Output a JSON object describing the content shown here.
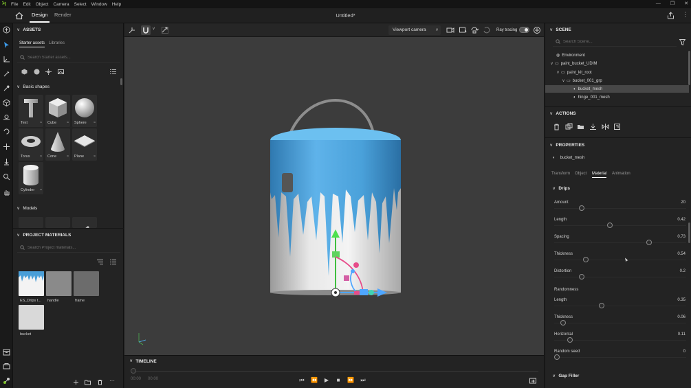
{
  "menu": [
    "File",
    "Edit",
    "Object",
    "Camera",
    "Select",
    "Window",
    "Help"
  ],
  "header": {
    "tabs": [
      "Design",
      "Render"
    ],
    "doc_title": "Untitled*"
  },
  "assets": {
    "title": "ASSETS",
    "tabs": [
      "Starter assets",
      "Libraries"
    ],
    "search_placeholder": "Search Starter assets...",
    "basic_shapes_title": "Basic shapes",
    "shapes": [
      "Text",
      "Cube",
      "Sphere",
      "Torus",
      "Cone",
      "Plane",
      "Cylinder"
    ],
    "models_title": "Models"
  },
  "project_materials": {
    "title": "PROJECT MATERIALS",
    "search_placeholder": "Search Project materials...",
    "items": [
      "ES_Drips t...",
      "handle",
      "frame",
      "bucket"
    ]
  },
  "viewport": {
    "camera": "Viewport camera",
    "ray_tracing_label": "Ray tracing",
    "ray_tracing_on": true
  },
  "timeline": {
    "title": "TIMELINE",
    "start": "00:00",
    "end": "00:00"
  },
  "scene": {
    "title": "SCENE",
    "search_placeholder": "Search Scene...",
    "tree": [
      "Environment",
      "paint_bucket_UDIM",
      "paint_kit_root",
      "bucket_001_grp",
      "bucket_mesh",
      "hinge_001_mesh"
    ]
  },
  "actions": {
    "title": "ACTIONS"
  },
  "properties": {
    "title": "PROPERTIES",
    "object_name": "bucket_mesh",
    "tabs": [
      "Transform",
      "Object",
      "Material",
      "Animation"
    ],
    "drips_title": "Drips",
    "drips": [
      {
        "label": "Amount",
        "value": "20",
        "pos": 0.21
      },
      {
        "label": "Length",
        "value": "0.42",
        "pos": 0.42
      },
      {
        "label": "Spacing",
        "value": "0.73",
        "pos": 0.72
      },
      {
        "label": "Thickness",
        "value": "0.54",
        "pos": 0.24
      },
      {
        "label": "Distortion",
        "value": "0.2",
        "pos": 0.21
      }
    ],
    "randomness_title": "Randomness",
    "randomness": [
      {
        "label": "Length",
        "value": "0.35",
        "pos": 0.36
      },
      {
        "label": "Thickness",
        "value": "0.06",
        "pos": 0.07
      },
      {
        "label": "Horizontal",
        "value": "0.11",
        "pos": 0.12
      },
      {
        "label": "Random seed",
        "value": "0",
        "pos": 0.02
      }
    ],
    "gap_filler_title": "Gap Filler"
  },
  "colors": {
    "paint": "#4a9fd8",
    "accent": "#7ec32a",
    "bg": "#232323",
    "viewport": "#3c3c3c"
  }
}
